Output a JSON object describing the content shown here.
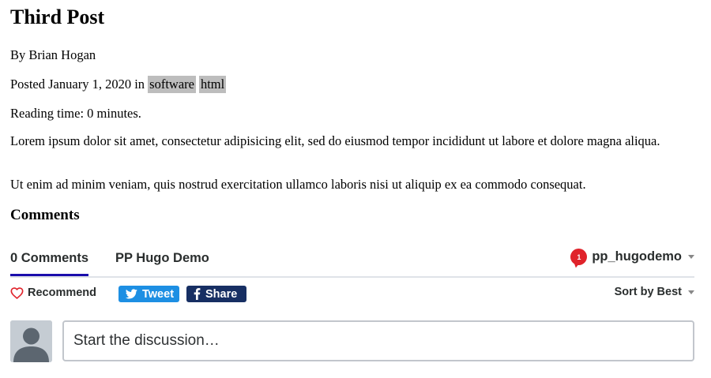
{
  "post": {
    "title": "Third Post",
    "byline": "By Brian Hogan",
    "posted_prefix": "Posted January 1, 2020 in",
    "tags": [
      "software",
      "html"
    ],
    "reading_time": "Reading time: 0 minutes.",
    "paragraphs": [
      "Lorem ipsum dolor sit amet, consectetur adipisicing elit, sed do eiusmod tempor incididunt ut labore et dolore magna aliqua.",
      "Ut enim ad minim veniam, quis nostrud exercitation ullamco laboris nisi ut aliquip ex ea commodo consequat."
    ],
    "comments_heading": "Comments"
  },
  "disqus": {
    "tabs": {
      "comments_count": "0 Comments",
      "site_name": "PP Hugo Demo"
    },
    "user": {
      "notification_count": "1",
      "username": "pp_hugodemo"
    },
    "actions": {
      "recommend_label": "Recommend",
      "tweet_label": "Tweet",
      "share_label": "Share",
      "sort_label": "Sort by Best"
    },
    "composer": {
      "placeholder": "Start the discussion…"
    },
    "colors": {
      "active_tab_underline": "#1a0dab",
      "notification_badge": "#e0232b",
      "recommend_heart": "#e0232b",
      "tweet_button": "#1d8fe3",
      "share_button": "#172f63",
      "avatar_bg": "#c5ccd3",
      "tag_bg": "#bdbdbd"
    },
    "icons": {
      "recommend": "heart-outline-icon",
      "tweet": "twitter-bird-icon",
      "share": "facebook-f-icon",
      "avatar": "default-user-avatar-icon",
      "dropdown": "caret-down-icon"
    }
  }
}
